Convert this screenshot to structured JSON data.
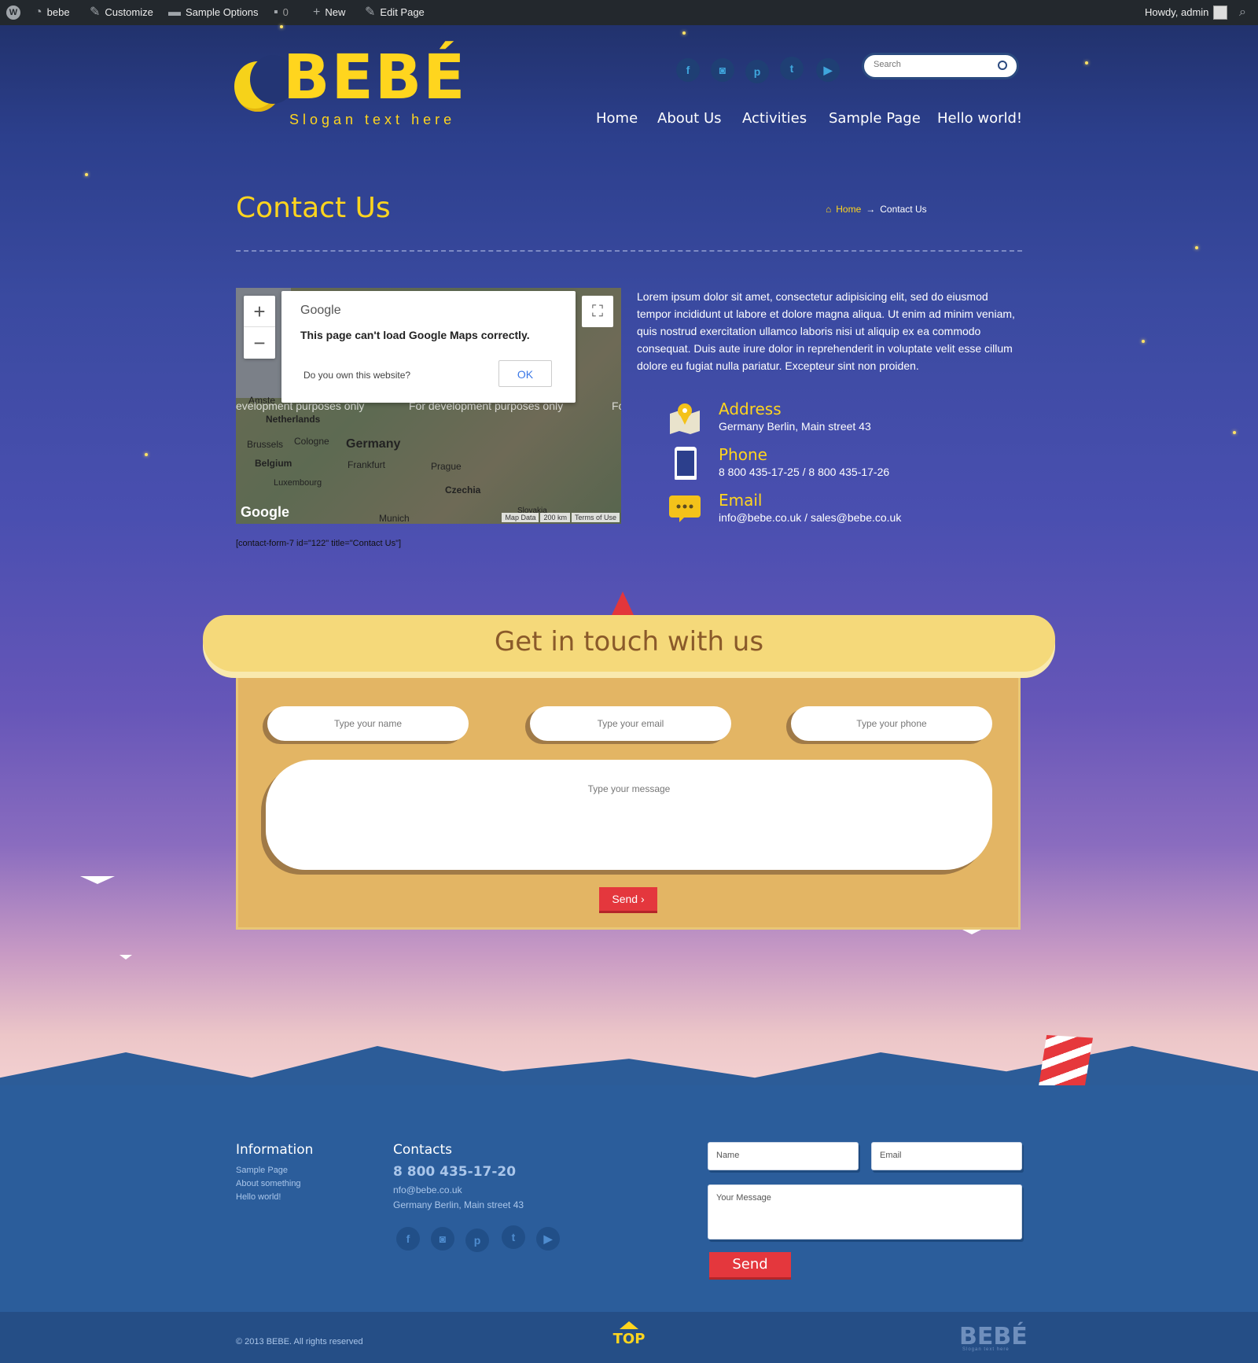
{
  "admin_bar": {
    "site_name": "bebe",
    "customize": "Customize",
    "sample_options": "Sample Options",
    "comments_count": "0",
    "new": "New",
    "edit_page": "Edit Page",
    "howdy": "Howdy, admin"
  },
  "logo": {
    "text": "BEBÉ",
    "slogan": "Slogan text here"
  },
  "search": {
    "placeholder": "Search"
  },
  "nav": [
    "Home",
    "About Us",
    "Activities",
    "Sample Page",
    "Hello world!"
  ],
  "social_icons": [
    "facebook-icon",
    "instagram-icon",
    "pinterest-icon",
    "twitter-icon",
    "youtube-icon"
  ],
  "page": {
    "title": "Contact Us",
    "breadcrumb_home": "Home",
    "breadcrumb_sep": "→",
    "breadcrumb_current": "Contact Us"
  },
  "map": {
    "dialog_brand": "Google",
    "dialog_title": "This page can't load Google Maps correctly.",
    "dialog_question": "Do you own this website?",
    "dialog_ok": "OK",
    "dev_text": "For development purposes only",
    "dev_text_left": "evelopment purposes only",
    "dev_text_right": "Fo",
    "labels": [
      "Amste",
      "Netherlands",
      "Brussels",
      "Cologne",
      "Germany",
      "Belgium",
      "Frankfurt",
      "Prague",
      "Luxembourg",
      "Czechia",
      "Munich",
      "Slovakia"
    ],
    "footer": [
      "Map Data",
      "200 km",
      "Terms of Use"
    ],
    "google_logo": "Google"
  },
  "intro_text": "Lorem ipsum dolor sit amet, consectetur adipisicing elit, sed do eiusmod tempor incididunt ut labore et dolore magna aliqua. Ut enim ad minim veniam, quis nostrud exercitation ullamco laboris nisi ut aliquip ex ea commodo consequat. Duis aute irure dolor in reprehenderit in voluptate velit esse cillum dolore eu fugiat nulla pariatur. Excepteur sint non proiden.",
  "contact_info": {
    "address_label": "Address",
    "address_value": "Germany Berlin, Main street 43",
    "phone_label": "Phone",
    "phone_value": "8 800 435-17-25 / 8 800 435-17-26",
    "email_label": "Email",
    "email_value": "info@bebe.co.uk / sales@bebe.co.uk"
  },
  "shortcode": "[contact-form-7 id=\"122\" title=\"Contact Us\"]",
  "form": {
    "title": "Get in touch with us",
    "name_placeholder": "Type your name",
    "email_placeholder": "Type your email",
    "phone_placeholder": "Type your phone",
    "message_placeholder": "Type your message",
    "send": "Send ›"
  },
  "footer": {
    "info_title": "Information",
    "info_links": [
      "Sample Page",
      "About something",
      "Hello world!"
    ],
    "contacts_title": "Contacts",
    "phone": "8 800 435-17-20",
    "email": "nfo@bebe.co.uk",
    "address": "Germany Berlin, Main street 43",
    "name_placeholder": "Name",
    "email_placeholder": "Email",
    "message_placeholder": "Your Message",
    "send": "Send",
    "copyright": "© 2013 BEBE. All rights reserved",
    "top": "TOP",
    "logo": "BEBÉ",
    "logo_slogan": "Slogan text here"
  },
  "colors": {
    "accent": "#ffd51e",
    "button": "#e4373d",
    "board": "#e3b564"
  }
}
